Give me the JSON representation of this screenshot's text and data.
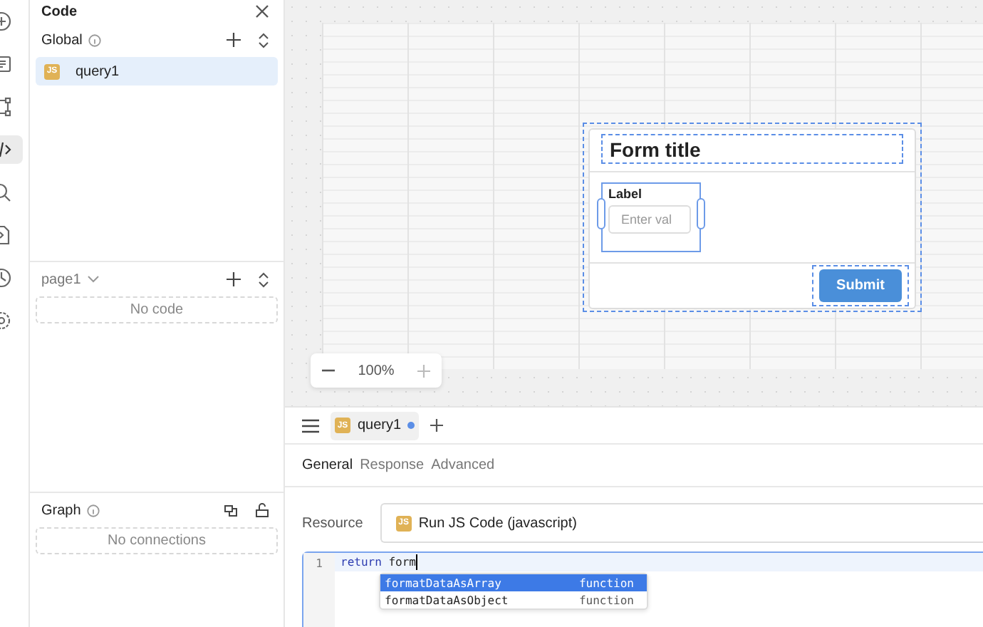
{
  "rail": [
    {
      "kind": "add",
      "selected": false
    },
    {
      "kind": "doc",
      "selected": false
    },
    {
      "kind": "nodes",
      "selected": false
    },
    {
      "kind": "code",
      "selected": true
    },
    {
      "kind": "search",
      "selected": false
    },
    {
      "kind": "export",
      "selected": false
    },
    {
      "kind": "history",
      "selected": false
    },
    {
      "kind": "settings",
      "selected": false
    }
  ],
  "sidebar": {
    "title": "Code",
    "global": {
      "label": "Global",
      "items": [
        {
          "name": "query1",
          "badge": "JS",
          "selected": true
        }
      ]
    },
    "page": {
      "label": "page1",
      "empty": "No code"
    },
    "graph": {
      "label": "Graph",
      "empty": "No connections"
    }
  },
  "canvas": {
    "form": {
      "title": "Form title",
      "field_label": "Label",
      "placeholder": "Enter val",
      "button": "Submit"
    },
    "zoom": "100%"
  },
  "editor_tabs": [
    {
      "name": "query1",
      "badge": "JS",
      "unsaved": true,
      "selected": true
    }
  ],
  "tabs": [
    {
      "label": "General",
      "selected": true
    },
    {
      "label": "Response",
      "selected": false
    },
    {
      "label": "Advanced",
      "selected": false
    }
  ],
  "resource": {
    "label": "Resource",
    "badge": "JS",
    "value": "Run JS Code (javascript)"
  },
  "code": {
    "lines": [
      {
        "number": "1",
        "keyword": "return",
        "text": "form"
      }
    ],
    "suggestions": [
      {
        "label": "formatDataAsArray",
        "type": "function",
        "selected": true
      },
      {
        "label": "formatDataAsObject",
        "type": "function",
        "selected": false
      }
    ]
  }
}
